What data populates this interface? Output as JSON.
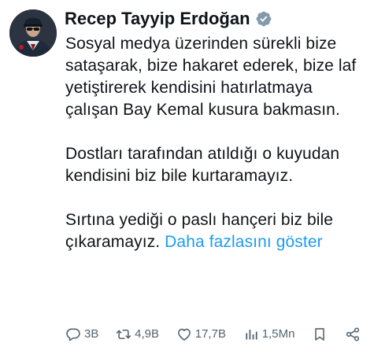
{
  "author": {
    "name": "Recep Tayyip Erdoğan",
    "verified": true,
    "verified_color": "#829aab"
  },
  "tweet": {
    "paragraphs": [
      "Sosyal medya üzerinden sürekli bize sataşarak, bize hakaret ederek, bize laf yetiştirerek kendisini hatırlatmaya çalışan Bay Kemal kusura bakmasın.",
      "Dostları tarafından atıldığı o kuyudan kendisini biz bile kurtaramayız.",
      "Sırtına yediği o paslı hançeri biz bile çıkaramayız."
    ],
    "show_more_label": "Daha fazlasını göster"
  },
  "actions": {
    "replies": "3B",
    "retweets": "4,9B",
    "likes": "17,7B",
    "views": "1,5Mn"
  },
  "colors": {
    "text": "#0f1419",
    "muted": "#536471",
    "link": "#1d9bf0"
  }
}
